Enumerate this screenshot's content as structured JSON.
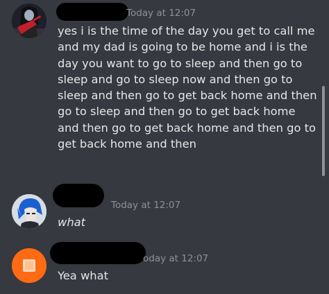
{
  "messages": [
    {
      "author_redacted": true,
      "timestamp": "Today at 12:07",
      "avatar": "dark-character-avatar-with-red-guitar",
      "content": "yes i is the time of the day you get to call me\nand my dad is going to be home and i is the\nday you want to go to sleep and then go to\nsleep and go to sleep now and then go to\nsleep and then go to get back home and then\ngo to sleep and then go to get back home\nand then go to get back home and then go to\nget back home and then"
    },
    {
      "author_redacted": true,
      "timestamp": "Today at 12:07",
      "avatar": "blue-haired-character-avatar",
      "content": "what"
    },
    {
      "author_redacted": true,
      "timestamp": "oday at 12:07",
      "avatar": "orange-default-avatar",
      "content": "Yea what"
    }
  ],
  "colors": {
    "background": "#36393f",
    "timestamp": "#8e9297",
    "text": "#e6e6e7",
    "orange_avatar": "#ff6a14"
  }
}
